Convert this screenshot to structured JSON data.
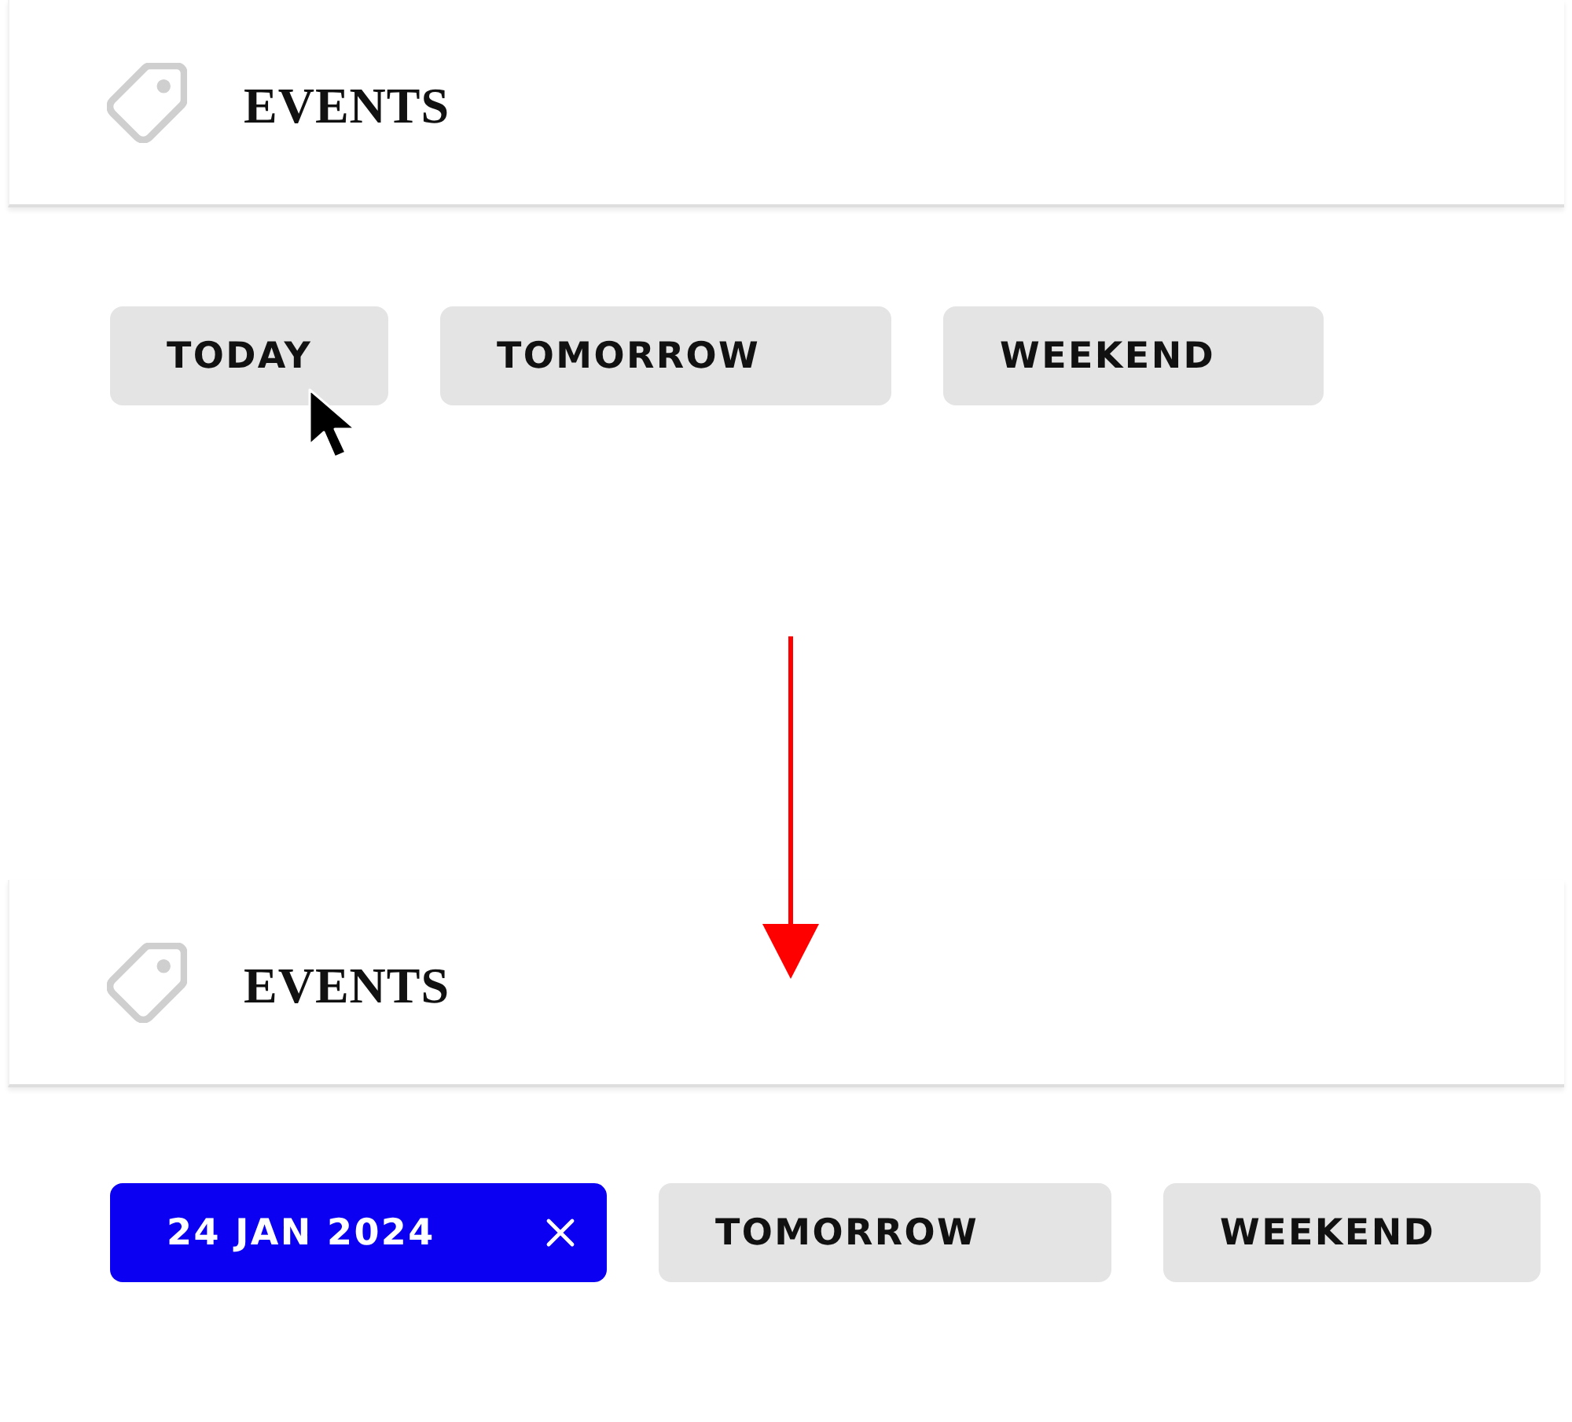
{
  "panels": [
    {
      "title": "EVENTS",
      "chips": [
        {
          "label": "TODAY",
          "selected": false,
          "hovered": true
        },
        {
          "label": "TOMORROW",
          "selected": false,
          "hovered": false
        },
        {
          "label": "WEEKEND",
          "selected": false,
          "hovered": false
        }
      ]
    },
    {
      "title": "EVENTS",
      "chips": [
        {
          "label": "24 JAN 2024",
          "selected": true,
          "hovered": false
        },
        {
          "label": "TOMORROW",
          "selected": false,
          "hovered": false
        },
        {
          "label": "WEEKEND",
          "selected": false,
          "hovered": false
        }
      ]
    }
  ]
}
